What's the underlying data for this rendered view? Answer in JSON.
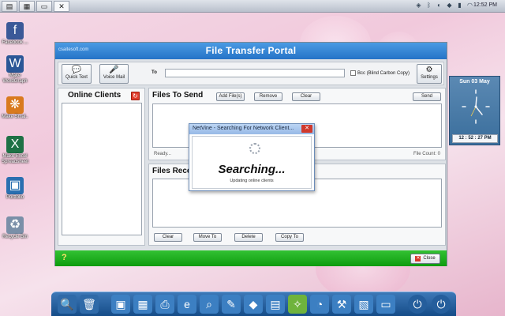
{
  "window": {
    "title": "File Transfer Portal",
    "url": "csaitesoft.com"
  },
  "toolbar": {
    "quick_text_label": "Quick Text",
    "voice_mail_label": "Voice Mail",
    "to_label": "To",
    "to_value": "",
    "bcc_label": "Bcc (Blind Carbon Copy)",
    "settings_label": "Settings"
  },
  "online_clients": {
    "title": "Online Clients"
  },
  "files_to_send": {
    "title": "Files To Send",
    "add_label": "Add File(s)",
    "remove_label": "Remove",
    "clear_label": "Clear",
    "send_label": "Send",
    "status": "Ready...",
    "file_count": "File Count: 0"
  },
  "files_received": {
    "title": "Files Rece",
    "clear_label": "Clear",
    "move_label": "Move To",
    "delete_label": "Delete",
    "copy_label": "Copy To"
  },
  "footer": {
    "help": "?",
    "close_label": "Close"
  },
  "dialog": {
    "title": "NetVine - Searching For Network Client...",
    "message": "Searching...",
    "sub_message": "Updating online clients"
  },
  "clock_widget": {
    "date": "Sun  03 May",
    "time": "12 : 52 : 27 PM"
  },
  "taskbar": {
    "time": "12:52 PM"
  },
  "desktop_icons": [
    {
      "label": "Facebook ...",
      "icon": "facebook-icon",
      "color": "#3b5998"
    },
    {
      "label": "Make WordGraph",
      "icon": "word-icon",
      "color": "#2b5797"
    },
    {
      "label": "Make Smal..",
      "icon": "butterfly-icon",
      "color": "#d97a1e"
    },
    {
      "label": "Make Excel Spreadsheet",
      "icon": "excel-icon",
      "color": "#1e7145"
    },
    {
      "label": "Portfolio",
      "icon": "portfolio-icon",
      "color": "#2a6fb0"
    },
    {
      "label": "Recycle Bin",
      "icon": "recycle-bin-icon",
      "color": "#7a8fa8"
    }
  ],
  "colors": {
    "title_bar": "#2573c7",
    "footer": "#0e9b0e",
    "dock": "#154c88"
  }
}
